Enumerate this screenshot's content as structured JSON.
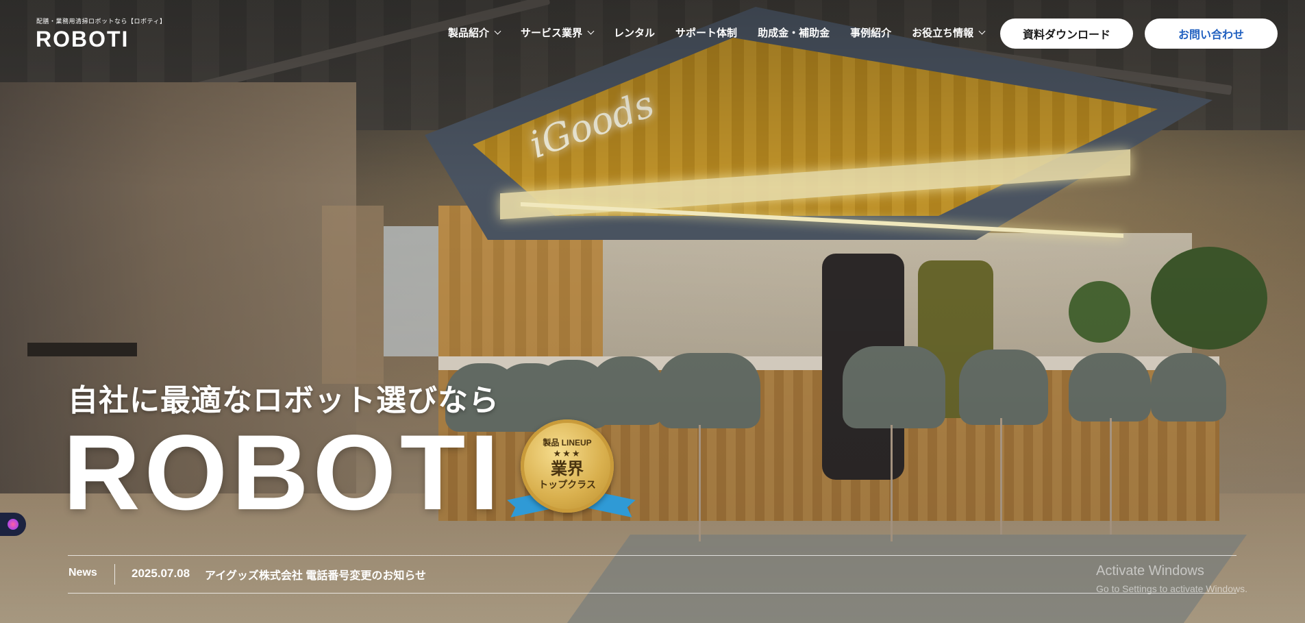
{
  "header": {
    "tagline": "配膳・業務用清掃ロボットなら【ロボティ】",
    "logo": "ROBOTI",
    "nav": [
      {
        "label": "製品紹介",
        "dropdown": true
      },
      {
        "label": "サービス業界",
        "dropdown": true
      },
      {
        "label": "レンタル",
        "dropdown": false
      },
      {
        "label": "サポート体制",
        "dropdown": false
      },
      {
        "label": "助成金・補助金",
        "dropdown": false
      },
      {
        "label": "事例紹介",
        "dropdown": false
      },
      {
        "label": "お役立ち情報",
        "dropdown": true
      }
    ],
    "download_button": "資料ダウンロード",
    "contact_button": "お問い合わせ"
  },
  "hero": {
    "subtitle": "自社に最適なロボット選びなら",
    "title": "ROBOTI",
    "badge": {
      "line1": "製品 LINEUP",
      "stars": "★★★",
      "line2": "業界",
      "line3": "トップクラス"
    },
    "neon_sign": "iGoods"
  },
  "news": {
    "label": "News",
    "date": "2025.07.08",
    "title": "アイグッズ株式会社 電話番号変更のお知らせ"
  },
  "watermark": {
    "title": "Activate Windows",
    "subtitle": "Go to Settings to activate Windows."
  },
  "colors": {
    "contact_text": "#1f5fbf",
    "button_bg": "#ffffff"
  }
}
